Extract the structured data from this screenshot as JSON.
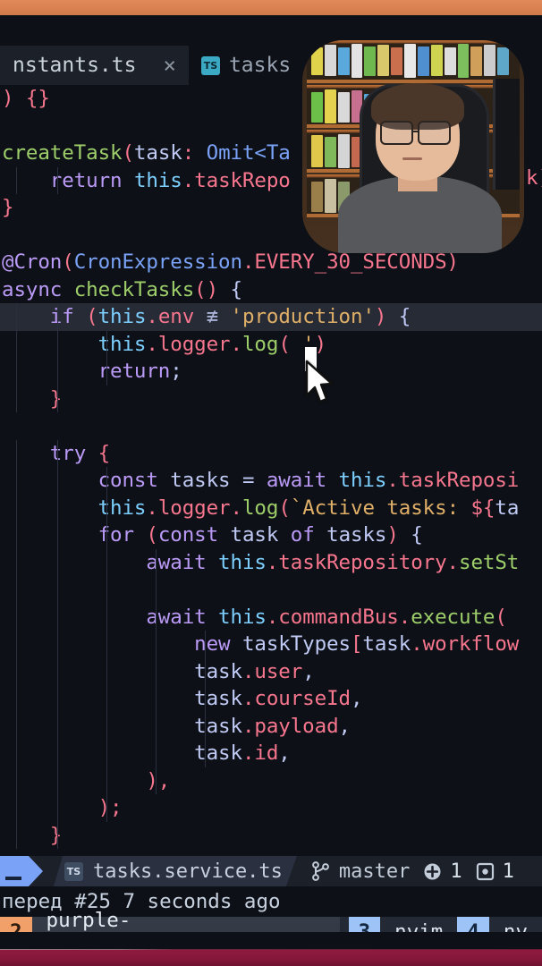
{
  "window": {
    "top_band_color": "#d9814f",
    "bottom_band_color": "#85173a",
    "background": "#0d1117"
  },
  "tabs": [
    {
      "label": "nstants.ts",
      "icon": "typescript-file-icon",
      "close": "×",
      "active": true
    },
    {
      "label": "tasks",
      "icon": "typescript-file-icon",
      "close": "",
      "active": false
    }
  ],
  "code": {
    "language": "typescript",
    "lines": [
      [
        {
          "t": ") {}",
          "c": "prp"
        }
      ],
      [],
      [
        {
          "t": "createTask",
          "c": "grn"
        },
        {
          "t": "(",
          "c": "prp"
        },
        {
          "t": "task",
          "c": "var"
        },
        {
          "t": ": ",
          "c": "prp"
        },
        {
          "t": "Omit<Ta",
          "c": "fn"
        }
      ],
      [
        {
          "t": "    ",
          "c": "var"
        },
        {
          "t": "return",
          "c": "kw"
        },
        {
          "t": " ",
          "c": "var"
        },
        {
          "t": "this",
          "c": "typ"
        },
        {
          "t": ".",
          "c": "prp"
        },
        {
          "t": "taskRepo",
          "c": "prp"
        }
      ],
      [
        {
          "t": "}",
          "c": "prp"
        }
      ],
      [],
      [
        {
          "t": "@Cron",
          "c": "kw"
        },
        {
          "t": "(",
          "c": "prp"
        },
        {
          "t": "CronExpression",
          "c": "fn"
        },
        {
          "t": ".",
          "c": "prp"
        },
        {
          "t": "EVERY_30_SECONDS",
          "c": "prp"
        },
        {
          "t": ")",
          "c": "prp"
        }
      ],
      [
        {
          "t": "async",
          "c": "kw"
        },
        {
          "t": " ",
          "c": "var"
        },
        {
          "t": "checkTasks",
          "c": "grn"
        },
        {
          "t": "()",
          "c": "prp"
        },
        {
          "t": " {",
          "c": "var"
        }
      ],
      [
        {
          "t": "    ",
          "c": "var"
        },
        {
          "t": "if",
          "c": "kw"
        },
        {
          "t": " ",
          "c": "var"
        },
        {
          "t": "(",
          "c": "prp"
        },
        {
          "t": "this",
          "c": "typ"
        },
        {
          "t": ".",
          "c": "prp"
        },
        {
          "t": "env",
          "c": "prp"
        },
        {
          "t": " ≢ ",
          "c": "dim2"
        },
        {
          "t": "'production'",
          "c": "str"
        },
        {
          "t": ")",
          "c": "prp"
        },
        {
          "t": " {",
          "c": "var"
        }
      ],
      [
        {
          "t": "        ",
          "c": "var"
        },
        {
          "t": "this",
          "c": "typ"
        },
        {
          "t": ".",
          "c": "prp"
        },
        {
          "t": "logger",
          "c": "prp"
        },
        {
          "t": ".",
          "c": "prp"
        },
        {
          "t": "log",
          "c": "grn"
        },
        {
          "t": "(",
          "c": "prp"
        },
        {
          "t": " '",
          "c": "str"
        },
        {
          "t": ")",
          "c": "prp"
        }
      ],
      [
        {
          "t": "        ",
          "c": "var"
        },
        {
          "t": "return",
          "c": "kw"
        },
        {
          "t": ";",
          "c": "var"
        }
      ],
      [
        {
          "t": "    }",
          "c": "prp"
        }
      ],
      [],
      [
        {
          "t": "    ",
          "c": "var"
        },
        {
          "t": "try",
          "c": "kw"
        },
        {
          "t": " {",
          "c": "prp"
        }
      ],
      [
        {
          "t": "        ",
          "c": "var"
        },
        {
          "t": "const",
          "c": "kw"
        },
        {
          "t": " ",
          "c": "var"
        },
        {
          "t": "tasks",
          "c": "var"
        },
        {
          "t": " = ",
          "c": "var"
        },
        {
          "t": "await",
          "c": "kw"
        },
        {
          "t": " ",
          "c": "var"
        },
        {
          "t": "this",
          "c": "typ"
        },
        {
          "t": ".",
          "c": "prp"
        },
        {
          "t": "taskReposi",
          "c": "prp"
        }
      ],
      [
        {
          "t": "        ",
          "c": "var"
        },
        {
          "t": "this",
          "c": "typ"
        },
        {
          "t": ".",
          "c": "prp"
        },
        {
          "t": "logger",
          "c": "prp"
        },
        {
          "t": ".",
          "c": "prp"
        },
        {
          "t": "log",
          "c": "grn"
        },
        {
          "t": "(",
          "c": "prp"
        },
        {
          "t": "`Active tasks: ",
          "c": "str"
        },
        {
          "t": "${",
          "c": "prp"
        },
        {
          "t": "ta",
          "c": "var"
        }
      ],
      [
        {
          "t": "        ",
          "c": "var"
        },
        {
          "t": "for",
          "c": "kw"
        },
        {
          "t": " ",
          "c": "var"
        },
        {
          "t": "(",
          "c": "prp"
        },
        {
          "t": "const",
          "c": "kw"
        },
        {
          "t": " ",
          "c": "var"
        },
        {
          "t": "task",
          "c": "var"
        },
        {
          "t": " ",
          "c": "var"
        },
        {
          "t": "of",
          "c": "kw"
        },
        {
          "t": " ",
          "c": "var"
        },
        {
          "t": "tasks",
          "c": "var"
        },
        {
          "t": ")",
          "c": "prp"
        },
        {
          "t": " {",
          "c": "var"
        }
      ],
      [
        {
          "t": "            ",
          "c": "var"
        },
        {
          "t": "await",
          "c": "kw"
        },
        {
          "t": " ",
          "c": "var"
        },
        {
          "t": "this",
          "c": "typ"
        },
        {
          "t": ".",
          "c": "prp"
        },
        {
          "t": "taskRepository",
          "c": "prp"
        },
        {
          "t": ".",
          "c": "prp"
        },
        {
          "t": "setSt",
          "c": "grn"
        }
      ],
      [],
      [
        {
          "t": "            ",
          "c": "var"
        },
        {
          "t": "await",
          "c": "kw"
        },
        {
          "t": " ",
          "c": "var"
        },
        {
          "t": "this",
          "c": "typ"
        },
        {
          "t": ".",
          "c": "prp"
        },
        {
          "t": "commandBus",
          "c": "prp"
        },
        {
          "t": ".",
          "c": "prp"
        },
        {
          "t": "execute",
          "c": "grn"
        },
        {
          "t": "(",
          "c": "prp"
        }
      ],
      [
        {
          "t": "                ",
          "c": "var"
        },
        {
          "t": "new",
          "c": "kw"
        },
        {
          "t": " ",
          "c": "var"
        },
        {
          "t": "taskTypes",
          "c": "var"
        },
        {
          "t": "[",
          "c": "prp"
        },
        {
          "t": "task",
          "c": "var"
        },
        {
          "t": ".",
          "c": "prp"
        },
        {
          "t": "workflow",
          "c": "prp"
        }
      ],
      [
        {
          "t": "                ",
          "c": "var"
        },
        {
          "t": "task",
          "c": "var"
        },
        {
          "t": ".",
          "c": "prp"
        },
        {
          "t": "user",
          "c": "prp"
        },
        {
          "t": ",",
          "c": "var"
        }
      ],
      [
        {
          "t": "                ",
          "c": "var"
        },
        {
          "t": "task",
          "c": "var"
        },
        {
          "t": ".",
          "c": "prp"
        },
        {
          "t": "courseId",
          "c": "prp"
        },
        {
          "t": ",",
          "c": "var"
        }
      ],
      [
        {
          "t": "                ",
          "c": "var"
        },
        {
          "t": "task",
          "c": "var"
        },
        {
          "t": ".",
          "c": "prp"
        },
        {
          "t": "payload",
          "c": "prp"
        },
        {
          "t": ",",
          "c": "var"
        }
      ],
      [
        {
          "t": "                ",
          "c": "var"
        },
        {
          "t": "task",
          "c": "var"
        },
        {
          "t": ".",
          "c": "prp"
        },
        {
          "t": "id",
          "c": "prp"
        },
        {
          "t": ",",
          "c": "var"
        }
      ],
      [
        {
          "t": "            ",
          "c": "var"
        },
        {
          "t": "),",
          "c": "prp"
        }
      ],
      [
        {
          "t": "        ",
          "c": "var"
        },
        {
          "t": ");",
          "c": "prp"
        }
      ],
      [
        {
          "t": "    ",
          "c": "var"
        },
        {
          "t": "}",
          "c": "prp"
        }
      ]
    ],
    "selected_line_index": 8,
    "cursor": {
      "line_index": 9,
      "visible": true
    },
    "right_overflow_text": "k)"
  },
  "statusline": {
    "mode_indicator": "normal-mode",
    "file_icon": "typescript-file-icon",
    "filename": "tasks.service.ts",
    "git_branch_icon": "git-branch-icon",
    "git_branch": "master",
    "diff_added_icon": "diff-added-icon",
    "diff_added": "1",
    "diff_modified_icon": "diff-modified-icon",
    "diff_modified": "1"
  },
  "notification": {
    "text": "перед #25  7 seconds ago"
  },
  "tmux": {
    "windows": [
      {
        "index": "2",
        "name": "purple-school/automation",
        "active": true
      },
      {
        "index": "3",
        "name": "nvim",
        "active": false
      },
      {
        "index": "4",
        "name": "nv",
        "active": false
      }
    ]
  },
  "webcam": {
    "present": true,
    "description": "webcam-overlay"
  }
}
